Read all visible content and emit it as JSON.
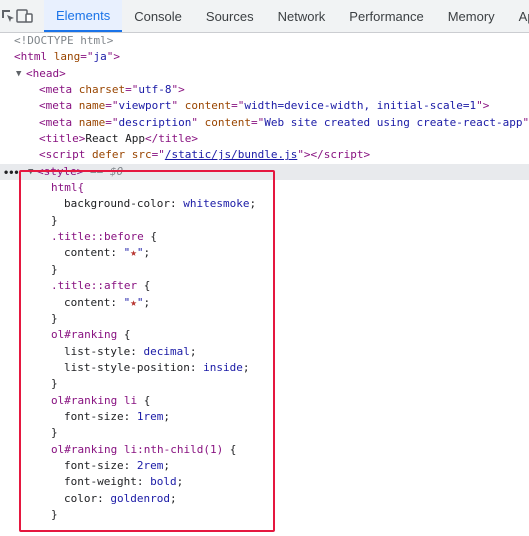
{
  "toolbar": {
    "tabs": [
      "Elements",
      "Console",
      "Sources",
      "Network",
      "Performance",
      "Memory",
      "App"
    ],
    "active_tab": "Elements"
  },
  "dom": {
    "doctype": "<!DOCTYPE html>",
    "html_open": {
      "tag": "html",
      "attr": "lang",
      "value": "ja"
    },
    "head_open": "head",
    "meta_charset": {
      "attr": "charset",
      "value": "utf-8"
    },
    "meta_viewport": {
      "attr1": "name",
      "val1": "viewport",
      "attr2": "content",
      "val2": "width=device-width, initial-scale=1"
    },
    "meta_description": {
      "attr1": "name",
      "val1": "description",
      "attr2": "content",
      "val2": "Web site created using create-react-app"
    },
    "title_text": "React App",
    "script_src": "/static/js/bundle.js",
    "style_selected_marker": "== $0"
  },
  "css": {
    "html_selector": "html{",
    "html_prop": "background-color",
    "html_val": "whitesmoke",
    "title_before_sel": ".title",
    "title_before_pseudo": "::before",
    "title_after_sel": ".title",
    "title_after_pseudo": "::after",
    "content_prop": "content",
    "star": "★",
    "ranking_sel": "ol#ranking",
    "list_style_prop": "list-style",
    "list_style_val": "decimal",
    "list_style_position_prop": "list-style-position",
    "list_style_position_val": "inside",
    "ranking_li_sel": "ol#ranking li",
    "font_size_prop": "font-size",
    "font_size_val": "1rem",
    "nth_sel": "ol#ranking li:nth-child(1)",
    "nth_font_size_val": "2rem",
    "font_weight_prop": "font-weight",
    "font_weight_val": "bold",
    "color_prop": "color",
    "color_val": "goldenrod"
  },
  "colors": {
    "accent": "#1a73e8",
    "highlight_border": "#e5173f",
    "star": "#b7342f"
  }
}
